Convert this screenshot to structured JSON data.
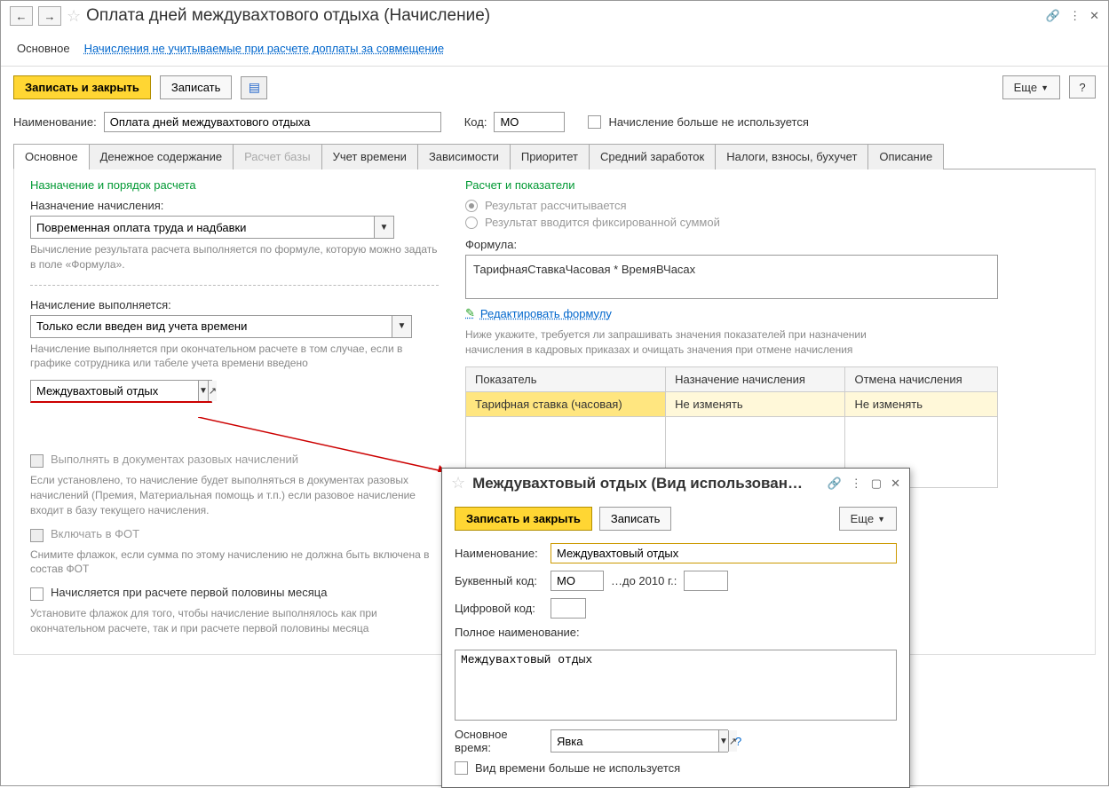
{
  "window": {
    "title": "Оплата дней междувахтового отдыха (Начисление)"
  },
  "nav": {
    "main": "Основное",
    "link": "Начисления не учитываемые при расчете доплаты за совмещение"
  },
  "toolbar": {
    "save_close": "Записать и закрыть",
    "save": "Записать",
    "more": "Еще",
    "help": "?"
  },
  "header": {
    "name_label": "Наименование:",
    "name_value": "Оплата дней междувахтового отдыха",
    "code_label": "Код:",
    "code_value": "МО",
    "unused_label": "Начисление больше не используется"
  },
  "tabs": [
    "Основное",
    "Денежное содержание",
    "Расчет базы",
    "Учет времени",
    "Зависимости",
    "Приоритет",
    "Средний заработок",
    "Налоги, взносы, бухучет",
    "Описание"
  ],
  "left": {
    "section": "Назначение и порядок расчета",
    "purpose_label": "Назначение начисления:",
    "purpose_value": "Повременная оплата труда и надбавки",
    "purpose_hint": "Вычисление результата расчета выполняется по формуле, которую можно задать в поле «Формула».",
    "exec_label": "Начисление выполняется:",
    "exec_value": "Только если введен вид учета времени",
    "exec_hint": "Начисление выполняется при окончательном расчете в том случае, если в графике сотрудника или табеле учета времени введено",
    "time_kind_value": "Междувахтовый отдых",
    "cb1": "Выполнять в документах разовых начислений",
    "cb1_hint": "Если установлено, то начисление будет выполняться в документах разовых начислений (Премия, Материальная помощь и т.п.) если разовое начисление входит в базу текущего начисления.",
    "cb2": "Включать в ФОТ",
    "cb2_hint": "Снимите флажок, если сумма по этому начислению не должна быть включена в состав ФОТ",
    "cb3": "Начисляется при расчете первой половины месяца",
    "cb3_hint": "Установите флажок для того, чтобы начисление выполнялось как при окончательном расчете, так и при расчете первой половины месяца"
  },
  "right": {
    "section": "Расчет и показатели",
    "r1": "Результат рассчитывается",
    "r2": "Результат вводится фиксированной суммой",
    "formula_label": "Формула:",
    "formula_value": "ТарифнаяСтавкаЧасовая * ВремяВЧасах",
    "edit_formula": "Редактировать формулу",
    "table_hint": "Ниже укажите, требуется ли запрашивать значения показателей при назначении начисления в кадровых приказах и очищать значения при отмене начисления",
    "th1": "Показатель",
    "th2": "Назначение начисления",
    "th3": "Отмена начисления",
    "row1_c1": "Тарифная ставка (часовая)",
    "row1_c2": "Не изменять",
    "row1_c3": "Не изменять"
  },
  "dialog": {
    "title": "Междувахтовый отдых (Вид использован…",
    "save_close": "Записать и закрыть",
    "save": "Записать",
    "more": "Еще",
    "name_label": "Наименование:",
    "name_value": "Междувахтовый отдых",
    "letter_label": "Буквенный код:",
    "letter_value": "МО",
    "pre2010_label": "…до 2010 г.:",
    "num_label": "Цифровой код:",
    "full_label": "Полное наименование:",
    "full_value": "Междувахтовый отдых",
    "main_time_label": "Основное время:",
    "main_time_value": "Явка",
    "unused_label": "Вид времени больше не используется"
  }
}
